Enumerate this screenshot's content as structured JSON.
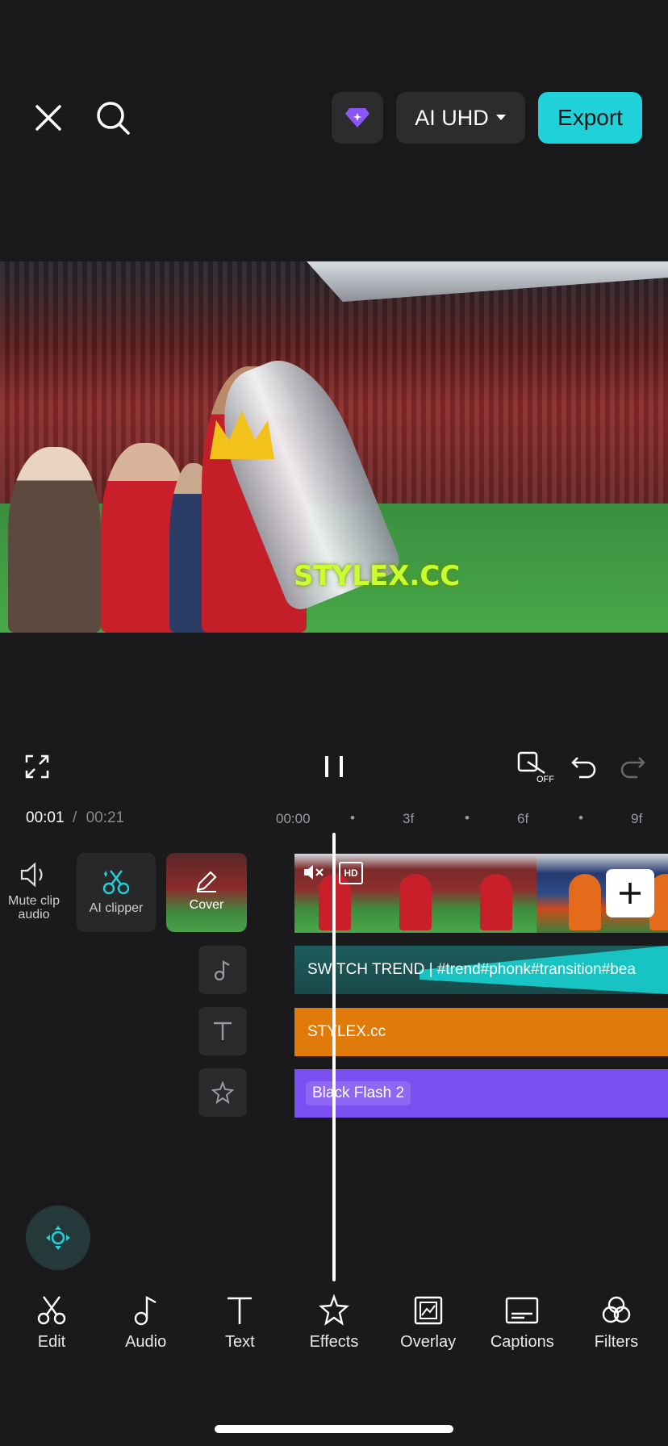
{
  "top_bar": {
    "quality_label": "AI UHD",
    "export_label": "Export",
    "accent_color": "#1fd1d8"
  },
  "preview": {
    "watermark_text": "STYLEX.CC"
  },
  "timeline": {
    "current_time": "00:01",
    "separator": "/",
    "total_time": "00:21",
    "ruler": [
      "00:00",
      "3f",
      "6f",
      "9f"
    ],
    "left_tools": {
      "mute_label": "Mute clip audio",
      "ai_clipper_label": "AI clipper",
      "cover_label": "Cover"
    },
    "tracks": {
      "music": "SWITCH TREND | #trend#phonk#transition#bea",
      "text": "STYLEX.cc",
      "effect": "Black Flash 2"
    },
    "colors": {
      "music": "#1d5c5c",
      "text": "#df7a0b",
      "effect": "#7c4ff2"
    }
  },
  "toolbar": {
    "items": [
      {
        "label": "Edit",
        "icon": "scissors-icon"
      },
      {
        "label": "Audio",
        "icon": "music-note-icon"
      },
      {
        "label": "Text",
        "icon": "text-icon"
      },
      {
        "label": "Effects",
        "icon": "star-icon"
      },
      {
        "label": "Overlay",
        "icon": "overlay-icon"
      },
      {
        "label": "Captions",
        "icon": "captions-icon"
      },
      {
        "label": "Filters",
        "icon": "filters-icon"
      }
    ]
  }
}
